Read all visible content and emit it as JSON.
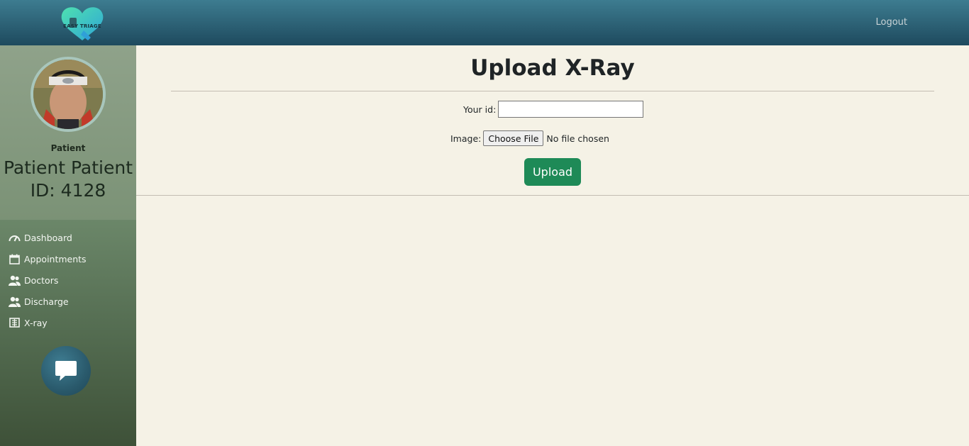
{
  "header": {
    "logo_text": "EASY TRIAGE",
    "logout_label": "Logout"
  },
  "profile": {
    "role": "Patient",
    "name": "Patient Patient",
    "id_text": "ID: 4128"
  },
  "nav": {
    "items": [
      {
        "label": "Dashboard",
        "icon": "speedometer-icon"
      },
      {
        "label": "Appointments",
        "icon": "calendar-icon"
      },
      {
        "label": "Doctors",
        "icon": "users-icon"
      },
      {
        "label": "Discharge",
        "icon": "users-icon"
      },
      {
        "label": "X-ray",
        "icon": "xray-icon"
      }
    ]
  },
  "chat": {
    "icon": "chat-bubble-icon"
  },
  "form": {
    "title": "Upload X-Ray",
    "id_label": "Your id:",
    "id_value": "",
    "image_label": "Image:",
    "choose_file_label": "Choose File",
    "no_file_text": "No file chosen",
    "upload_label": "Upload"
  },
  "colors": {
    "header_top": "#3d7c90",
    "header_bottom": "#1e4a5e",
    "sidebar_top": "#8ea58b",
    "sidebar_bottom": "#3e5138",
    "content_bg": "#f5f2e6",
    "upload_button": "#1e8a57"
  }
}
